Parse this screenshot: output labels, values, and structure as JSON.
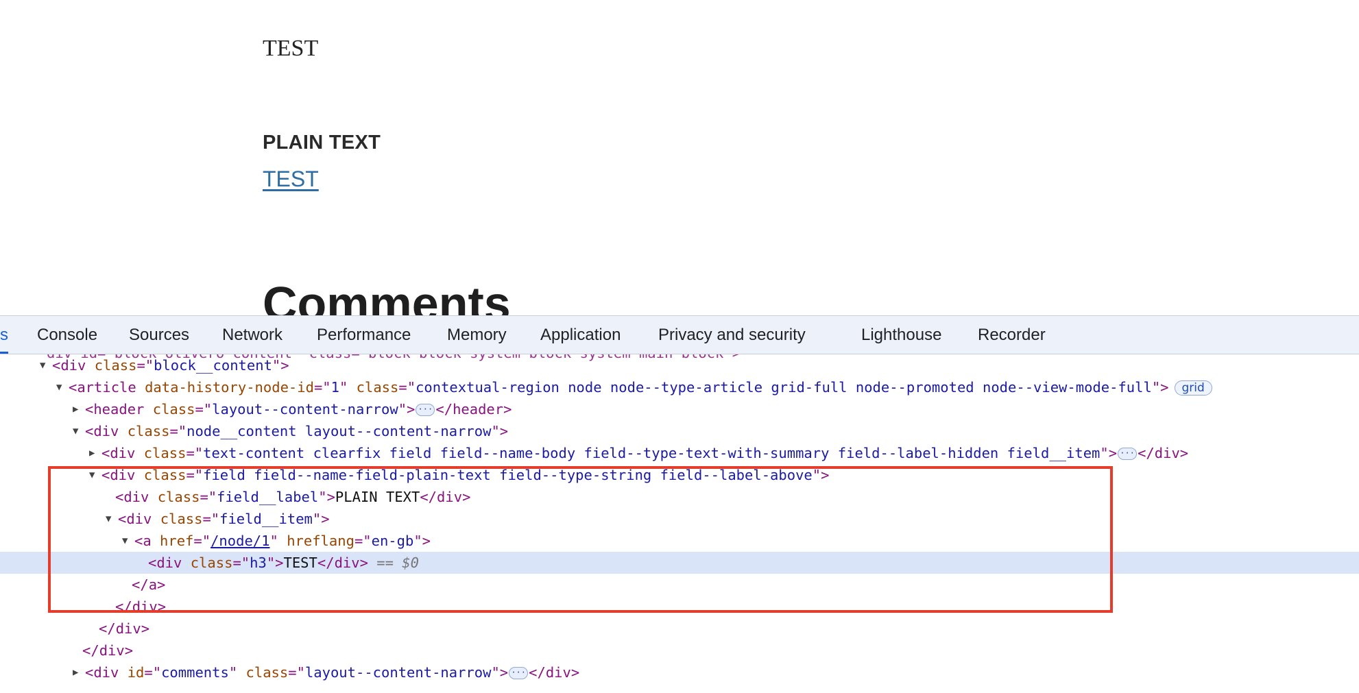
{
  "page": {
    "body_text": "TEST",
    "field_label": "PLAIN TEXT",
    "field_link": "TEST",
    "comments_heading": "Comments"
  },
  "devtools": {
    "tabs": [
      {
        "label": "s",
        "active": true
      },
      {
        "label": "Console"
      },
      {
        "label": "Sources"
      },
      {
        "label": "Network"
      },
      {
        "label": "Performance"
      },
      {
        "label": "Memory"
      },
      {
        "label": "Application"
      },
      {
        "label": "Privacy and security"
      },
      {
        "label": "Lighthouse"
      },
      {
        "label": "Recorder"
      }
    ],
    "accent_color": "#1a5fd1",
    "highlight_color": "#e53d2b",
    "selected_row_color": "#d9e4f9",
    "tree": {
      "cut_row": "div id=\"block-olivero-content\" class=\"block block-system block-system-main-block\">",
      "r1_tag": "div",
      "r1_a1": "class",
      "r1_v1": "block__content",
      "r2_tag": "article",
      "r2_a1": "data-history-node-id",
      "r2_v1": "1",
      "r2_a2": "class",
      "r2_v2": "contextual-region node node--type-article grid-full node--promoted node--view-mode-full",
      "r2_badge": "grid",
      "r3_tag": "header",
      "r3_a1": "class",
      "r3_v1": "layout--content-narrow",
      "r3_close": "header",
      "r4_tag": "div",
      "r4_a1": "class",
      "r4_v1": "node__content layout--content-narrow",
      "r5_tag": "div",
      "r5_a1": "class",
      "r5_v1": "text-content clearfix field field--name-body field--type-text-with-summary field--label-hidden field__item",
      "r5_close": "div",
      "r6_tag": "div",
      "r6_a1": "class",
      "r6_v1": "field field--name-field-plain-text field--type-string field--label-above",
      "r7_tag": "div",
      "r7_a1": "class",
      "r7_v1": "field__label",
      "r7_text": "PLAIN TEXT",
      "r7_close": "div",
      "r8_tag": "div",
      "r8_a1": "class",
      "r8_v1": "field__item",
      "r9_tag": "a",
      "r9_a1": "href",
      "r9_v1": "/node/1",
      "r9_a2": "hreflang",
      "r9_v2": "en-gb",
      "r10_tag": "div",
      "r10_a1": "class",
      "r10_v1": "h3",
      "r10_text": "TEST",
      "r10_close": "div",
      "r10_ref": "== $0",
      "r11_close": "a",
      "r12_close": "div",
      "r13_close": "div",
      "r14_close": "div",
      "r15_tag": "div",
      "r15_a1": "id",
      "r15_v1": "comments",
      "r15_a2": "class",
      "r15_v2": "layout--content-narrow",
      "r15_close": "div"
    }
  }
}
